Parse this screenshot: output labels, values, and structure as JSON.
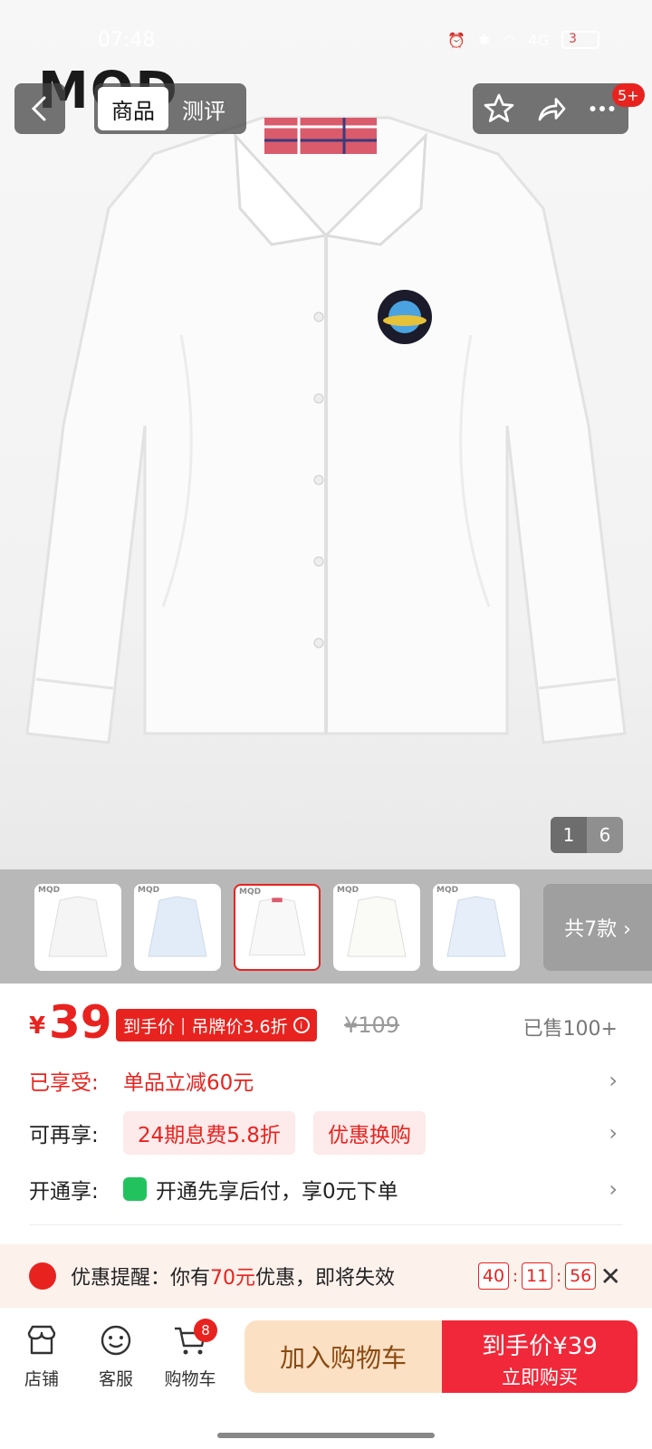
{
  "status_bar": {
    "time": "07:48",
    "network": "4G",
    "battery": "3"
  },
  "hero": {
    "brand_logo": "MQD",
    "page_current": "1",
    "page_total": "6"
  },
  "header": {
    "tabs": [
      {
        "label": "商品",
        "active": true
      },
      {
        "label": "测评",
        "active": false
      }
    ],
    "more_badge": "5+"
  },
  "thumbnails": {
    "items": [
      "MQD",
      "MQD",
      "MQD",
      "MQD",
      "MQD"
    ],
    "selected_index": 2,
    "more_label": "共7款 ›"
  },
  "price": {
    "currency": "¥",
    "value": "39",
    "tag_label": "到手价",
    "tag_discount": "吊牌价3.6折",
    "original": "¥109",
    "sold": "已售100+"
  },
  "promo": {
    "enjoyed_label": "已享受:",
    "enjoyed_value": "单品立减60元",
    "more_label": "可再享:",
    "chip1": "24期息费5.8折",
    "chip2": "优惠换购",
    "open_label": "开通享:",
    "open_value": "开通先享后付，享0元下单"
  },
  "reminder": {
    "prefix": "优惠提醒：你有",
    "amount": "70元",
    "suffix": "优惠，即将失效",
    "countdown": [
      "40",
      "11",
      "56"
    ]
  },
  "bottom": {
    "store": "店铺",
    "service": "客服",
    "cart": "购物车",
    "cart_count": "8",
    "add_to_cart": "加入购物车",
    "buy_line1": "到手价¥39",
    "buy_line2": "立即购买"
  }
}
